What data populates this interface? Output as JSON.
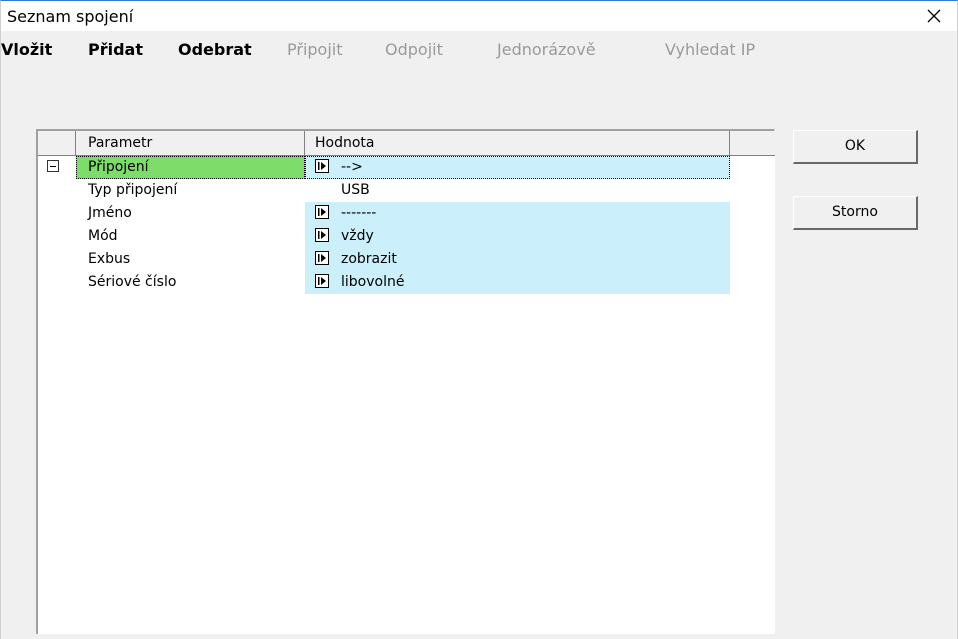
{
  "window": {
    "title": "Seznam spojení"
  },
  "menu": [
    {
      "label": "Vložit",
      "enabled": true
    },
    {
      "label": "Přidat",
      "enabled": true
    },
    {
      "label": "Odebrat",
      "enabled": true
    },
    {
      "label": "Připojit",
      "enabled": false
    },
    {
      "label": "Odpojit",
      "enabled": false
    },
    {
      "label": "Jednorázově",
      "enabled": false
    },
    {
      "label": "Vyhledat IP",
      "enabled": false
    }
  ],
  "grid": {
    "columns": [
      "Parametr",
      "Hodnota"
    ],
    "rows": [
      {
        "param": "Připojení",
        "value": "-->",
        "has_arrow": true,
        "selected": true,
        "group": true
      },
      {
        "param": "Typ připojení",
        "value": "USB",
        "has_arrow": false
      },
      {
        "param": "Jméno",
        "value": "-------",
        "has_arrow": true
      },
      {
        "param": "Mód",
        "value": "vždy",
        "has_arrow": true
      },
      {
        "param": "Exbus",
        "value": "zobrazit",
        "has_arrow": true
      },
      {
        "param": "Sériové číslo",
        "value": "libovolné",
        "has_arrow": true
      }
    ]
  },
  "buttons": {
    "ok": "OK",
    "cancel": "Storno"
  },
  "colors": {
    "selected_param_bg": "#7ddc6a",
    "value_bg": "#cceffc",
    "disabled_text": "#9a9a9a"
  }
}
